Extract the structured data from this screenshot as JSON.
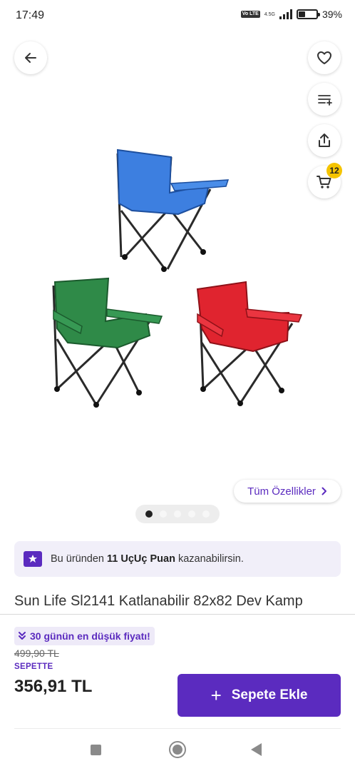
{
  "status_bar": {
    "time": "17:49",
    "volte": "Vo LTE",
    "network": "4.5G",
    "battery": "39%",
    "battery_level": 0.39
  },
  "top_actions": {
    "back_icon": "arrow-left-icon",
    "favorite_icon": "heart-icon",
    "compare_icon": "list-plus-icon",
    "share_icon": "share-icon",
    "cart_icon": "cart-icon",
    "cart_count": "12"
  },
  "gallery": {
    "features_label": "Tüm Özellikler",
    "dot_count": 5,
    "active_dot": 0,
    "chair_colors": [
      "#3d7fe0",
      "#2f8a48",
      "#e0242f"
    ]
  },
  "points_banner": {
    "prefix": "Bu üründen",
    "points": "11 UçUç Puan",
    "suffix": "kazanabilirsin."
  },
  "product": {
    "title": "Sun Life Sl2141 Katlanabilir 82x82 Dev Kamp"
  },
  "price_block": {
    "lowest_tag": "30 günün en düşük fiyatı!",
    "old_price": "499,90 TL",
    "basket_label": "SEPETTE",
    "price": "356,91 TL"
  },
  "add_to_cart": {
    "label": "Sepete Ekle"
  },
  "colors": {
    "brand": "#5b2bbf",
    "badge": "#f5c400"
  }
}
